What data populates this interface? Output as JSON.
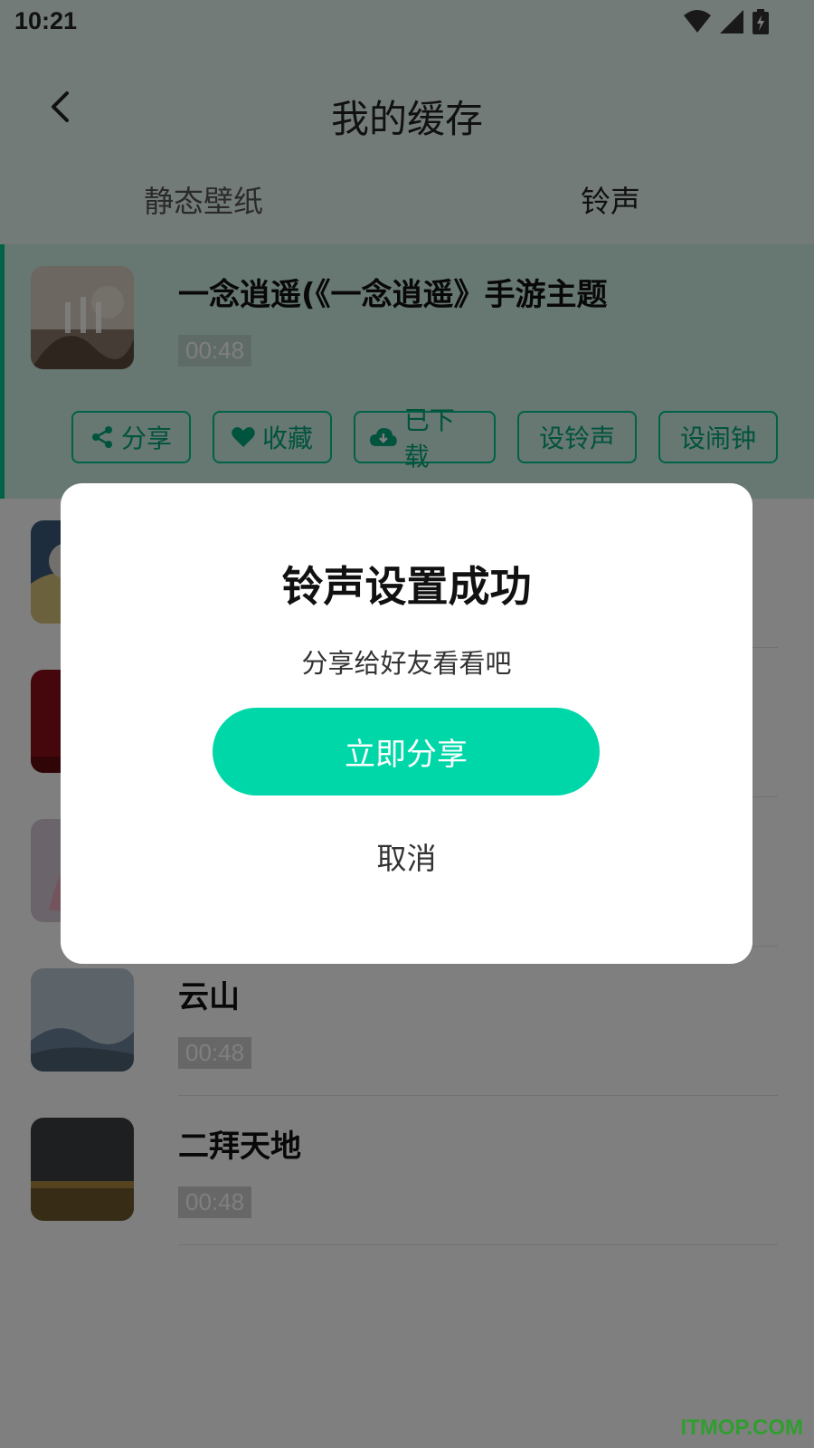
{
  "status_bar": {
    "time": "10:21"
  },
  "header": {
    "title": "我的缓存"
  },
  "tabs": [
    {
      "label": "静态壁纸"
    },
    {
      "label": "铃声"
    }
  ],
  "list": {
    "items": [
      {
        "title": "一念逍遥(《一念逍遥》手游主题",
        "duration": "00:48"
      },
      {
        "title": "",
        "duration": ""
      },
      {
        "title": "",
        "duration": ""
      },
      {
        "title": "",
        "duration": ""
      },
      {
        "title": "云山",
        "duration": "00:48"
      },
      {
        "title": "二拜天地",
        "duration": "00:48"
      }
    ]
  },
  "actions": {
    "share": "分享",
    "favorite": "收藏",
    "downloaded": "已下载",
    "set_ringtone": "设铃声",
    "set_alarm": "设闹钟"
  },
  "dialog": {
    "title": "铃声设置成功",
    "subtitle": "分享给好友看看吧",
    "primary": "立即分享",
    "cancel": "取消"
  },
  "watermark": "ITMOP.COM",
  "colors": {
    "accent": "#00c48f",
    "primary_button": "#00d7a9",
    "header_bg": "#e6f7f2",
    "active_row_bg": "#ceeee3"
  }
}
